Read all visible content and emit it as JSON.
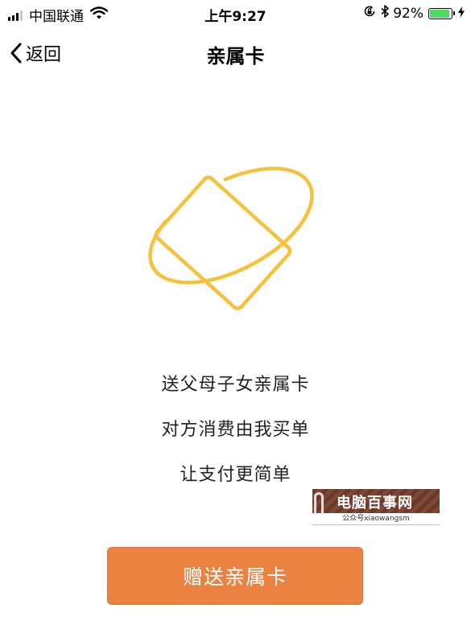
{
  "status_bar": {
    "carrier": "中国联通",
    "time": "上午9:27",
    "battery_percent": "92%",
    "battery_level": 0.92,
    "icons": [
      "signal-icon",
      "wifi-icon",
      "rotation-lock-icon",
      "bluetooth-icon",
      "battery-icon",
      "charging-icon"
    ]
  },
  "nav": {
    "back_label": "返回",
    "title": "亲属卡"
  },
  "description": {
    "line1": "送父母子女亲属卡",
    "line2": "对方消费由我买单",
    "line3": "让支付更简单"
  },
  "watermark": {
    "title": "电脑百事网",
    "subtitle": "公众号xiaowangsm"
  },
  "action": {
    "button_label": "赠送亲属卡"
  },
  "colors": {
    "accent": "#ec8242",
    "illustration": "#f8c13a",
    "battery": "#4cd964"
  }
}
